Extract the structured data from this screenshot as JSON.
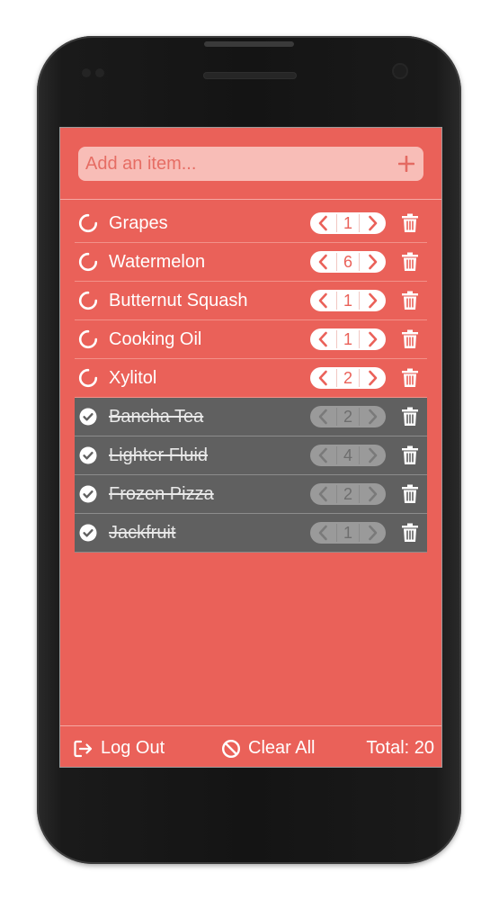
{
  "add_bar": {
    "placeholder": "Add an item...",
    "add_icon": "plus-icon"
  },
  "items": [
    {
      "name": "Grapes",
      "qty": "1",
      "done": false
    },
    {
      "name": "Watermelon",
      "qty": "6",
      "done": false
    },
    {
      "name": "Butternut Squash",
      "qty": "1",
      "done": false
    },
    {
      "name": "Cooking Oil",
      "qty": "1",
      "done": false
    },
    {
      "name": "Xylitol",
      "qty": "2",
      "done": false
    },
    {
      "name": "Bancha Tea",
      "qty": "2",
      "done": true
    },
    {
      "name": "Lighter Fluid",
      "qty": "4",
      "done": true
    },
    {
      "name": "Frozen Pizza",
      "qty": "2",
      "done": true
    },
    {
      "name": "Jackfruit",
      "qty": "1",
      "done": true
    }
  ],
  "footer": {
    "logout_label": "Log Out",
    "clear_label": "Clear All",
    "total_label": "Total: 20"
  },
  "colors": {
    "screen_bg": "#ea6159",
    "done_row_bg": "#606060",
    "input_bg": "#f8bdb7"
  }
}
